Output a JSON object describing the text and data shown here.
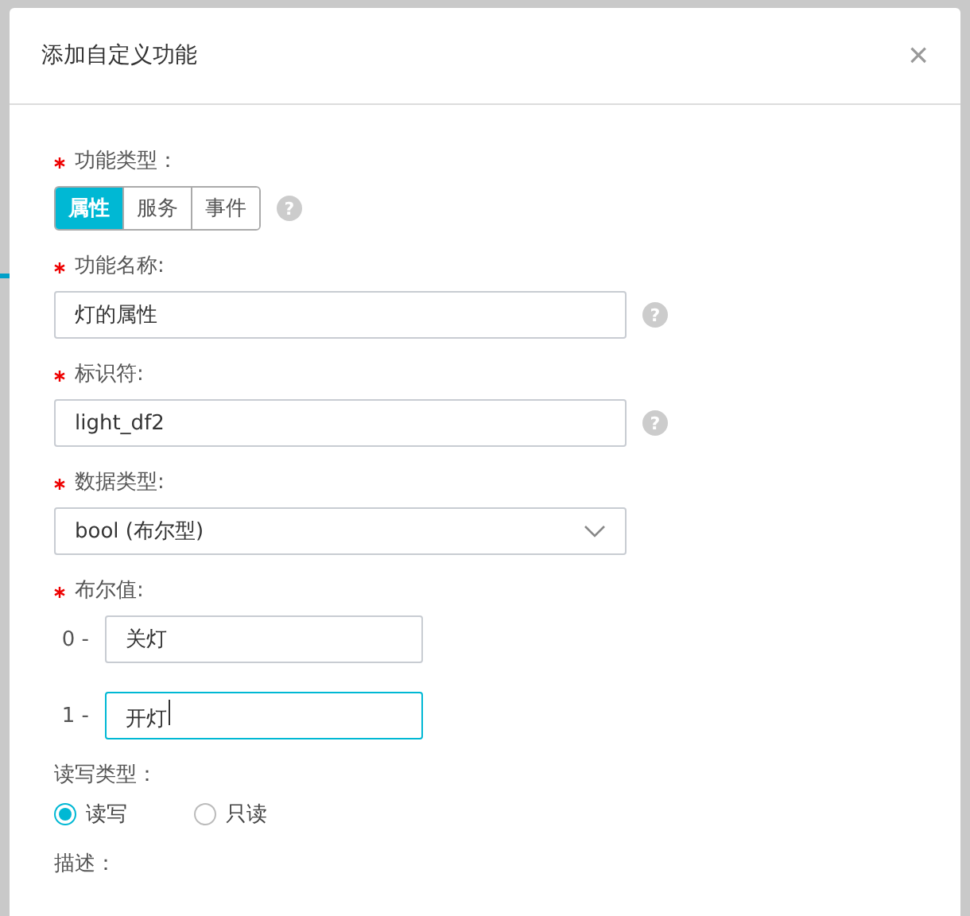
{
  "dialog": {
    "title": "添加自定义功能",
    "close": "×"
  },
  "fields": [
    {
      "kind": "segmented",
      "label": "功能类型：",
      "required": true,
      "help": "?",
      "options": [
        {
          "label": "属性",
          "selected": true
        },
        {
          "label": "服务",
          "selected": false
        },
        {
          "label": "事件",
          "selected": false
        }
      ]
    },
    {
      "kind": "text",
      "label": "功能名称:",
      "required": true,
      "help": "?",
      "value": "灯的属性"
    },
    {
      "kind": "text",
      "label": "标识符:",
      "required": true,
      "help": "?",
      "value": "light_df2"
    },
    {
      "kind": "select",
      "label": "数据类型:",
      "required": true,
      "value": "bool (布尔型)"
    },
    {
      "kind": "boolean",
      "label": "布尔值:",
      "required": true,
      "rows": [
        {
          "prefix": "0 -",
          "value": "关灯",
          "focused": false
        },
        {
          "prefix": "1 -",
          "value": "开灯",
          "focused": true
        }
      ]
    },
    {
      "kind": "radio",
      "label": "读写类型：",
      "required": false,
      "options": [
        {
          "label": "读写",
          "selected": true
        },
        {
          "label": "只读",
          "selected": false
        }
      ]
    },
    {
      "kind": "label",
      "label": "描述：",
      "required": false
    }
  ]
}
